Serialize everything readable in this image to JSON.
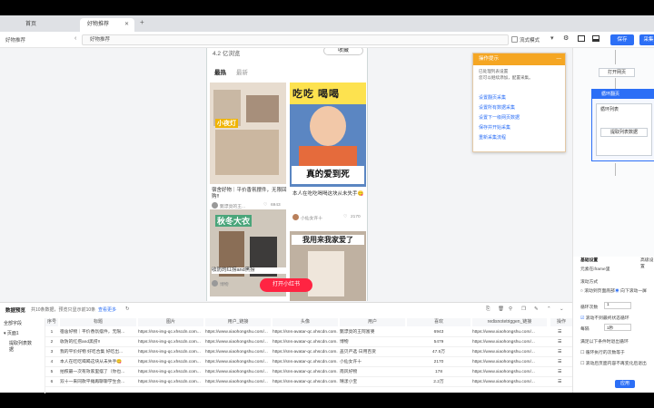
{
  "tabs": [
    {
      "label": "首页"
    },
    {
      "label": "好物推荐"
    }
  ],
  "url": {
    "page_label": "好物推荐",
    "address": "好物推荐",
    "mode_label": "流式模式",
    "save_label": "保存",
    "run_label": "采集"
  },
  "phone": {
    "rating": "4.2 亿浏览",
    "collect": "收藏",
    "sort_tabs": [
      "最热",
      "最新"
    ],
    "notes": [
      {
        "title": "宿舍好物｜平价香氛摆件，无限回购!!",
        "author": "甄漂亮的王...",
        "likes": "6943",
        "img_text": "小夜灯"
      },
      {
        "title": "本人在吃吃喝喝这块从未失手😋",
        "author": "小仙女许十",
        "likes": "2170",
        "img_text": "吃吃 喝喝",
        "img_sub": "真的爱到死"
      },
      {
        "title": "收防的红捞and黑捞",
        "author": "博物",
        "likes": "",
        "img_text": "秋冬大衣"
      },
      {
        "title": "",
        "author": "",
        "likes": "",
        "img_text": "我用来我家爱了"
      }
    ],
    "open_app": "打开小红书"
  },
  "popup": {
    "title": "操作提示",
    "desc1": "已处理列表设置",
    "desc2": "您可以继续添加，配置采集。",
    "links": [
      "设置翻页采集",
      "设置所有数据采集",
      "设置下一级网页数据",
      "保存并开始采集",
      "重新采集流程"
    ]
  },
  "workflow": {
    "open_page": "打开网页",
    "loop_title": "循环翻页",
    "loop_list": "循环列表",
    "extract": "提取列表数据"
  },
  "settings": {
    "tabs": [
      "基础设置",
      "高级设置"
    ],
    "iframe": "元素在iframe里",
    "method_label": "滚动方式",
    "methods": [
      "滚动到页面底部",
      "向下滚动一屏"
    ],
    "count_label": "循环次数",
    "count": "1",
    "loop_label": "元方式循环",
    "loop_until": "滚动不到最终状态循环",
    "interval_label": "每隔",
    "interval": "1秒",
    "stop_label": "满足以下条件时退出循环",
    "check1": "循环执行的次数等于",
    "check2": "滚动后页面内容不再变化后退出",
    "apply": "应用"
  },
  "data": {
    "tab_label": "数据预览",
    "summary": "共10条数据，预览只显示前10条",
    "more": "查看更多",
    "sidebar": [
      "全部字段",
      "页面1",
      "提取列表数据"
    ],
    "headers": [
      "序号",
      "标题",
      "图片",
      "用户_链接",
      "头像",
      "用户",
      "喜欢",
      "redisnotetriggen_链接",
      "操作"
    ],
    "rows": [
      [
        "1",
        "宿舍好物｜平价香氛摆件，无限...",
        "https://sns-img-qc.xhscdn.com...",
        "https://www.xiaohongshu.com/...",
        "https://sns-avatar-qc.xhscdn.com...",
        "甄漂亮的王阿富婆",
        "6943",
        "https://www.xiaohongshu.com/..."
      ],
      [
        "2",
        "收防的红捞and黑捞!!",
        "https://sns-img-qc.xhscdn.com...",
        "https://www.xiaohongshu.com/...",
        "https://sns-avatar-qc.xhscdn.com...",
        "博物",
        "5479",
        "https://www.xiaohongshu.com/..."
      ],
      [
        "3",
        "我的平价好物 好吃合集 好吃出...",
        "https://sns-img-qc.xhscdn.com...",
        "https://www.xiaohongshu.com/...",
        "https://sns-avatar-qc.xhscdn.com...",
        "盖贝严选·日用百货",
        "47.5万",
        "https://www.xiaohongshu.com/..."
      ],
      [
        "4",
        "本人在吃吃喝喝这块从未失手😋",
        "https://sns-img-qc.xhscdn.com...",
        "https://www.xiaohongshu.com/...",
        "https://sns-avatar-qc.xhscdn.com...",
        "小仙女许十",
        "2170",
        "https://www.xiaohongshu.com/..."
      ],
      [
        "5",
        "拍照最一次有效家里摆了（你也...",
        "https://sns-img-qc.xhscdn.com...",
        "https://www.xiaohongshu.com/...",
        "https://sns-avatar-qc.xhscdn.com...",
        "南风好物",
        "178",
        "https://www.xiaohongshu.com/..."
      ],
      [
        "6",
        "双十一来同款平摊再聊聊学生会...",
        "https://sns-img-qc.xhscdn.com...",
        "https://www.xiaohongshu.com/...",
        "https://sns-avatar-qc.xhscdn.com...",
        "晴漾小宝",
        "2.2万",
        "https://www.xiaohongshu.com/..."
      ]
    ]
  },
  "colors": {
    "accent": "#2c6ff6",
    "warning": "#f5a623",
    "brand_red": "#ff2442"
  }
}
